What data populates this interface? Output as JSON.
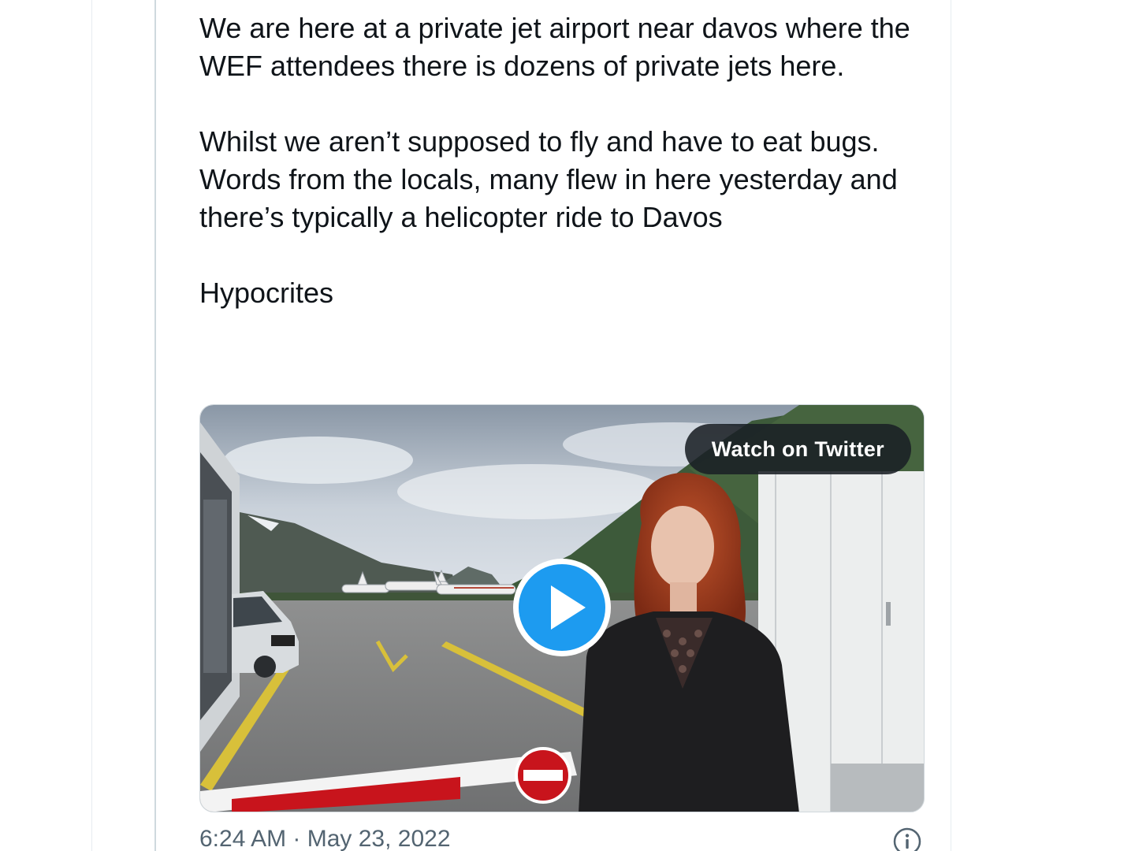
{
  "tweet": {
    "paragraphs": [
      "We are here at a private jet airport near davos where the WEF attendees there is dozens of private jets here.",
      "Whilst we aren’t supposed to fly and have to eat bugs.",
      "Words from the locals, many flew in here yesterday and there’s typically a helicopter ride to Davos",
      "Hypocrites"
    ],
    "timestamp": "6:24 AM · May 23, 2022"
  },
  "media": {
    "watch_label": "Watch on Twitter",
    "play_icon": "play-icon",
    "info_icon": "info-icon",
    "accent_color": "#1d9bf0"
  }
}
